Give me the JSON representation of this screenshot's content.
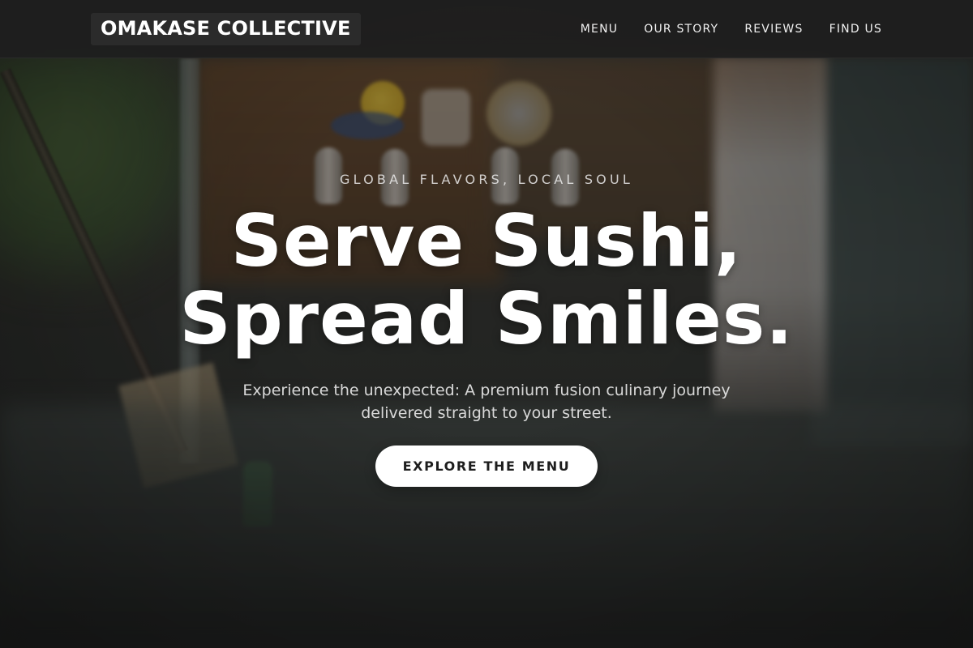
{
  "navbar": {
    "brand": "OMAKASE COLLECTIVE",
    "links": [
      {
        "label": "MENU"
      },
      {
        "label": "OUR STORY"
      },
      {
        "label": "REVIEWS"
      },
      {
        "label": "FIND US"
      }
    ]
  },
  "hero": {
    "eyebrow": "GLOBAL FLAVORS, LOCAL SOUL",
    "headline_line1": "Serve Sushi,",
    "headline_line2": "Spread Smiles.",
    "subtitle": "Experience the unexpected: A premium fusion culinary journey delivered straight to your street.",
    "cta_label": "EXPLORE THE MENU"
  },
  "colors": {
    "nav_background": "#1e1e1e",
    "brand_background": "#2b2b2b",
    "text_primary": "#ffffff",
    "cta_background": "#ffffff",
    "cta_text": "#1d1d1d"
  }
}
